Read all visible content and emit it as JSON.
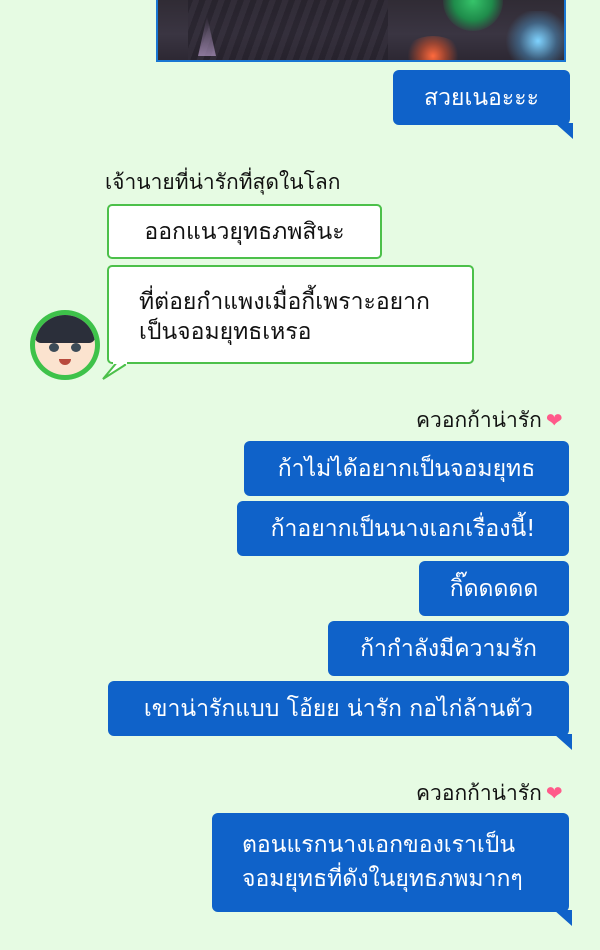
{
  "messages": {
    "m1": "สวยเนอะะะ",
    "sender1": "เจ้านายที่น่ารักที่สุดในโลก",
    "w1": "ออกแนวยุทธภพสินะ",
    "w2_line1": "ที่ต่อยกำแพงเมื่อกี้เพราะอยาก",
    "w2_line2": "เป็นจอมยุทธเหรอ",
    "sender2": "ควอกก้าน่ารัก",
    "b1": "ก้าไม่ได้อยากเป็นจอมยุทธ",
    "b2": "ก้าอยากเป็นนางเอกเรื่องนี้!",
    "b3": "กิ๊ดดดดด",
    "b4": "ก้ากำลังมีความรัก",
    "b5": "เขาน่ารักแบบ โอ้ยย น่ารัก กอไก่ล้านตัว",
    "sender3": "ควอกก้าน่ารัก",
    "b6_line1": "ตอนแรกนางเอกของเราเป็น",
    "b6_line2": "จอมยุทธที่ดังในยุทธภพมากๆ"
  },
  "icons": {
    "heart": "❤",
    "avatar": "chibi-boy-avatar"
  },
  "colors": {
    "background": "#e6fbe3",
    "blue_bubble": "#0f62c9",
    "white_bubble_border": "#4cc04a"
  }
}
